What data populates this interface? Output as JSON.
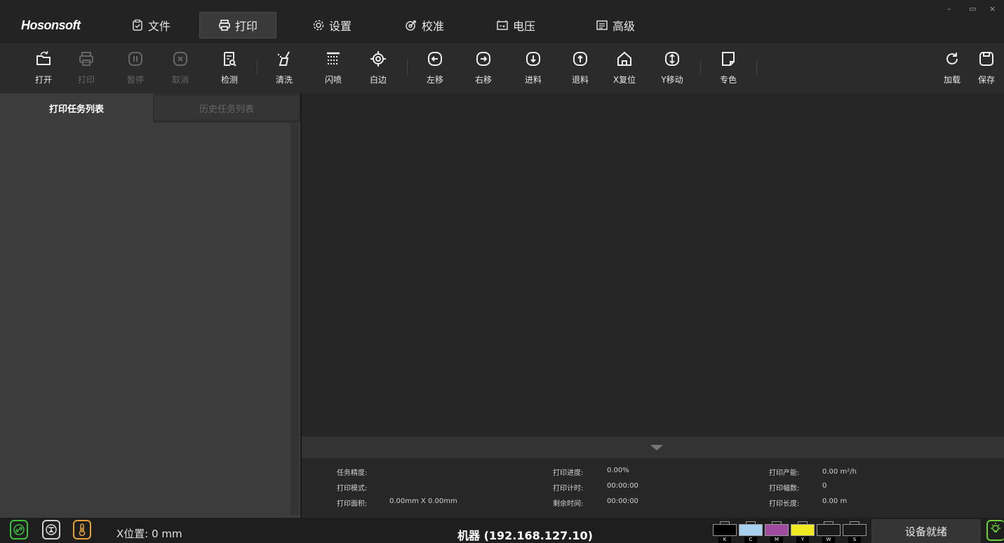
{
  "app": {
    "logo": "Hosonsoft"
  },
  "menu": [
    {
      "label": "文件",
      "icon": "file-check-icon"
    },
    {
      "label": "打印",
      "icon": "printer-icon",
      "active": true
    },
    {
      "label": "设置",
      "icon": "gear-icon"
    },
    {
      "label": "校准",
      "icon": "target-icon"
    },
    {
      "label": "电压",
      "icon": "battery-icon"
    },
    {
      "label": "高级",
      "icon": "list-icon"
    }
  ],
  "window_controls": {
    "minimize": "–",
    "restore": "▭",
    "close": "×"
  },
  "toolbar": {
    "open": "打开",
    "print": "打印",
    "pause": "暂停",
    "cancel": "取消",
    "detect": "检测",
    "clean": "清洗",
    "flash": "闪喷",
    "white_edge": "白边",
    "move_left": "左移",
    "move_right": "右移",
    "feed": "进料",
    "retract": "退料",
    "x_reset": "X复位",
    "y_move": "Y移动",
    "spot_color": "专色",
    "load": "加载",
    "save": "保存"
  },
  "tabs": {
    "queue": "打印任务列表",
    "history": "历史任务列表"
  },
  "info": {
    "task_precision_label": "任务精度:",
    "task_precision_value": "",
    "print_mode_label": "打印模式:",
    "print_mode_value": "",
    "print_area_label": "打印面积:",
    "print_area_value": "0.00mm X 0.00mm",
    "progress_label": "打印进度:",
    "progress_value": "0.00%",
    "timer_label": "打印计时:",
    "timer_value": "00:00:00",
    "remaining_label": "剩余时间:",
    "remaining_value": "00:00:00",
    "capacity_label": "打印产能:",
    "capacity_value": "0.00 m²/h",
    "count_label": "打印幅数:",
    "count_value": "0",
    "length_label": "打印长度:",
    "length_value": "0.00 m"
  },
  "status": {
    "x_position": "X位置: 0 mm",
    "machine": "机器  (192.168.127.10)",
    "ready": "设备就绪",
    "inks": [
      {
        "code": "K",
        "color": "#000000"
      },
      {
        "code": "C",
        "color": "#a8d0f0"
      },
      {
        "code": "M",
        "color": "#a04aa0"
      },
      {
        "code": "Y",
        "color": "#f0e820"
      },
      {
        "code": "W",
        "color": "#1a1a1a"
      },
      {
        "code": "S",
        "color": "#1a1a1a"
      }
    ],
    "link_color": "#3fbf3f",
    "temp_color": "#e8a23a",
    "bulb_color": "#6cd13a"
  }
}
